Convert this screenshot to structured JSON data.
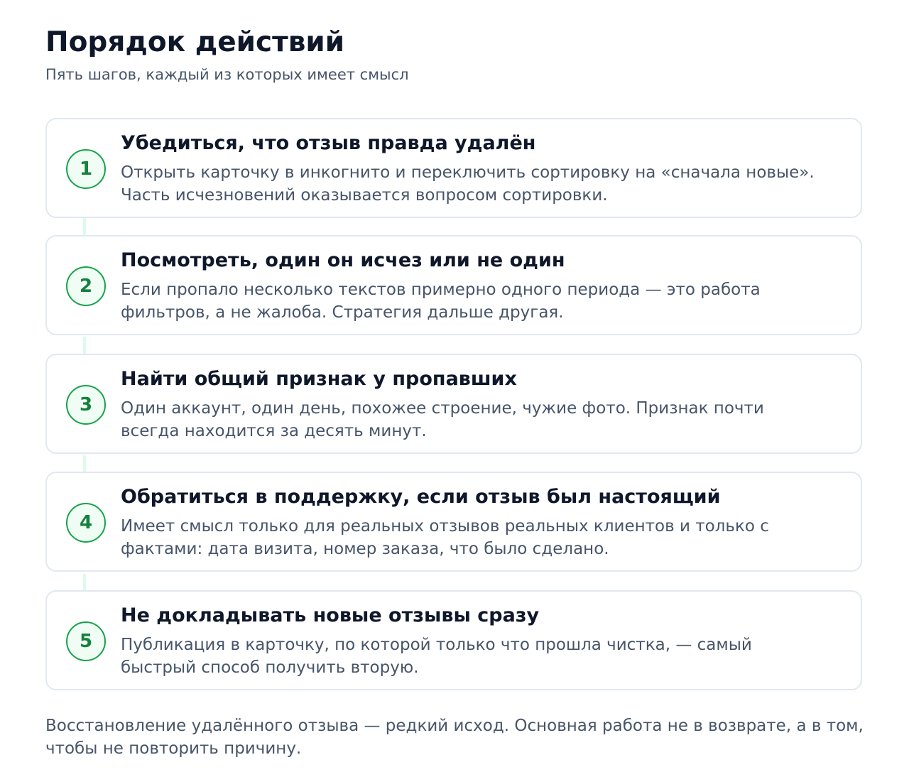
{
  "header": {
    "title": "Порядок действий",
    "subtitle": "Пять шагов, каждый из которых имеет смысл"
  },
  "steps": [
    {
      "number": "1",
      "title": "Убедиться, что отзыв правда удалён",
      "description": "Открыть карточку в инкогнито и переключить сортировку на «сначала новые». Часть исчезновений оказывается вопросом сортировки."
    },
    {
      "number": "2",
      "title": "Посмотреть, один он исчез или не один",
      "description": "Если пропало несколько текстов примерно одного периода — это работа фильтров, а не жалоба. Стратегия дальше другая."
    },
    {
      "number": "3",
      "title": "Найти общий признак у пропавших",
      "description": "Один аккаунт, один день, похожее строение, чужие фото. Признак почти всегда находится за десять минут."
    },
    {
      "number": "4",
      "title": "Обратиться в поддержку, если отзыв был настоящий",
      "description": "Имеет смысл только для реальных отзывов реальных клиентов и только с фактами: дата визита, номер заказа, что было сделано."
    },
    {
      "number": "5",
      "title": "Не докладывать новые отзывы сразу",
      "description": "Публикация в карточку, по которой только что прошла чистка, — самый быстрый способ получить вторую."
    }
  ],
  "footer": {
    "note": "Восстановление удалённого отзыва — редкий исход. Основная работа не в возврате, а в том, чтобы не повторить причину."
  },
  "colors": {
    "accent": "#16a34a",
    "accent_text": "#15803d",
    "accent_background": "#f0fdf4",
    "connector": "#dcfce7",
    "card_border": "#e2e8f0",
    "heading": "#0f172a",
    "body_text": "#475569"
  }
}
